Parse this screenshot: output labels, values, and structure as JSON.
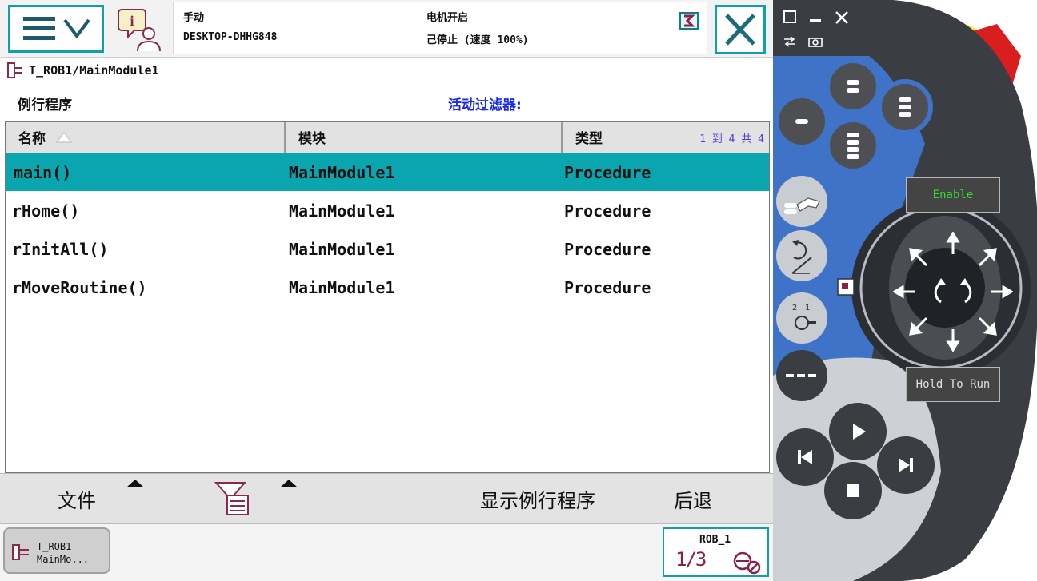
{
  "header": {
    "mode": "手动",
    "controller": "DESKTOP-DHHG848",
    "motor_state": "电机开启",
    "run_state": "己停止 (速度 100%)"
  },
  "breadcrumb": {
    "path": "T_ROB1/MainModule1"
  },
  "view": {
    "title": "例行程序",
    "filter_label": "活动过滤器:"
  },
  "table": {
    "columns": [
      "名称",
      "模块",
      "类型"
    ],
    "page_count": "1 到 4 共 4",
    "rows": [
      {
        "name": "main()",
        "module": "MainModule1",
        "type": "Procedure",
        "selected": true
      },
      {
        "name": "rHome()",
        "module": "MainModule1",
        "type": "Procedure",
        "selected": false
      },
      {
        "name": "rInitAll()",
        "module": "MainModule1",
        "type": "Procedure",
        "selected": false
      },
      {
        "name": "rMoveRoutine()",
        "module": "MainModule1",
        "type": "Procedure",
        "selected": false
      }
    ]
  },
  "toolbar": {
    "file_label": "文件",
    "show_routine_label": "显示例行程序",
    "back_label": "后退",
    "filter_icon": "filter-icon"
  },
  "taskbar": {
    "task_tab": "T_ROB1\nMainMo...",
    "quickset_robot": "ROB_1",
    "quickset_increment": "1/3"
  },
  "device": {
    "enable_label": "Enable",
    "hold_to_run_label": "Hold To Run"
  },
  "colors": {
    "accent_teal": "#0aa5ae",
    "filter_blue": "#1a2ae6",
    "device_gray": "#3a3d42",
    "device_blue": "#3f73c8",
    "estop_red": "#d81e1e",
    "estop_yellow": "#f3e818",
    "enable_green": "#33dd33"
  }
}
